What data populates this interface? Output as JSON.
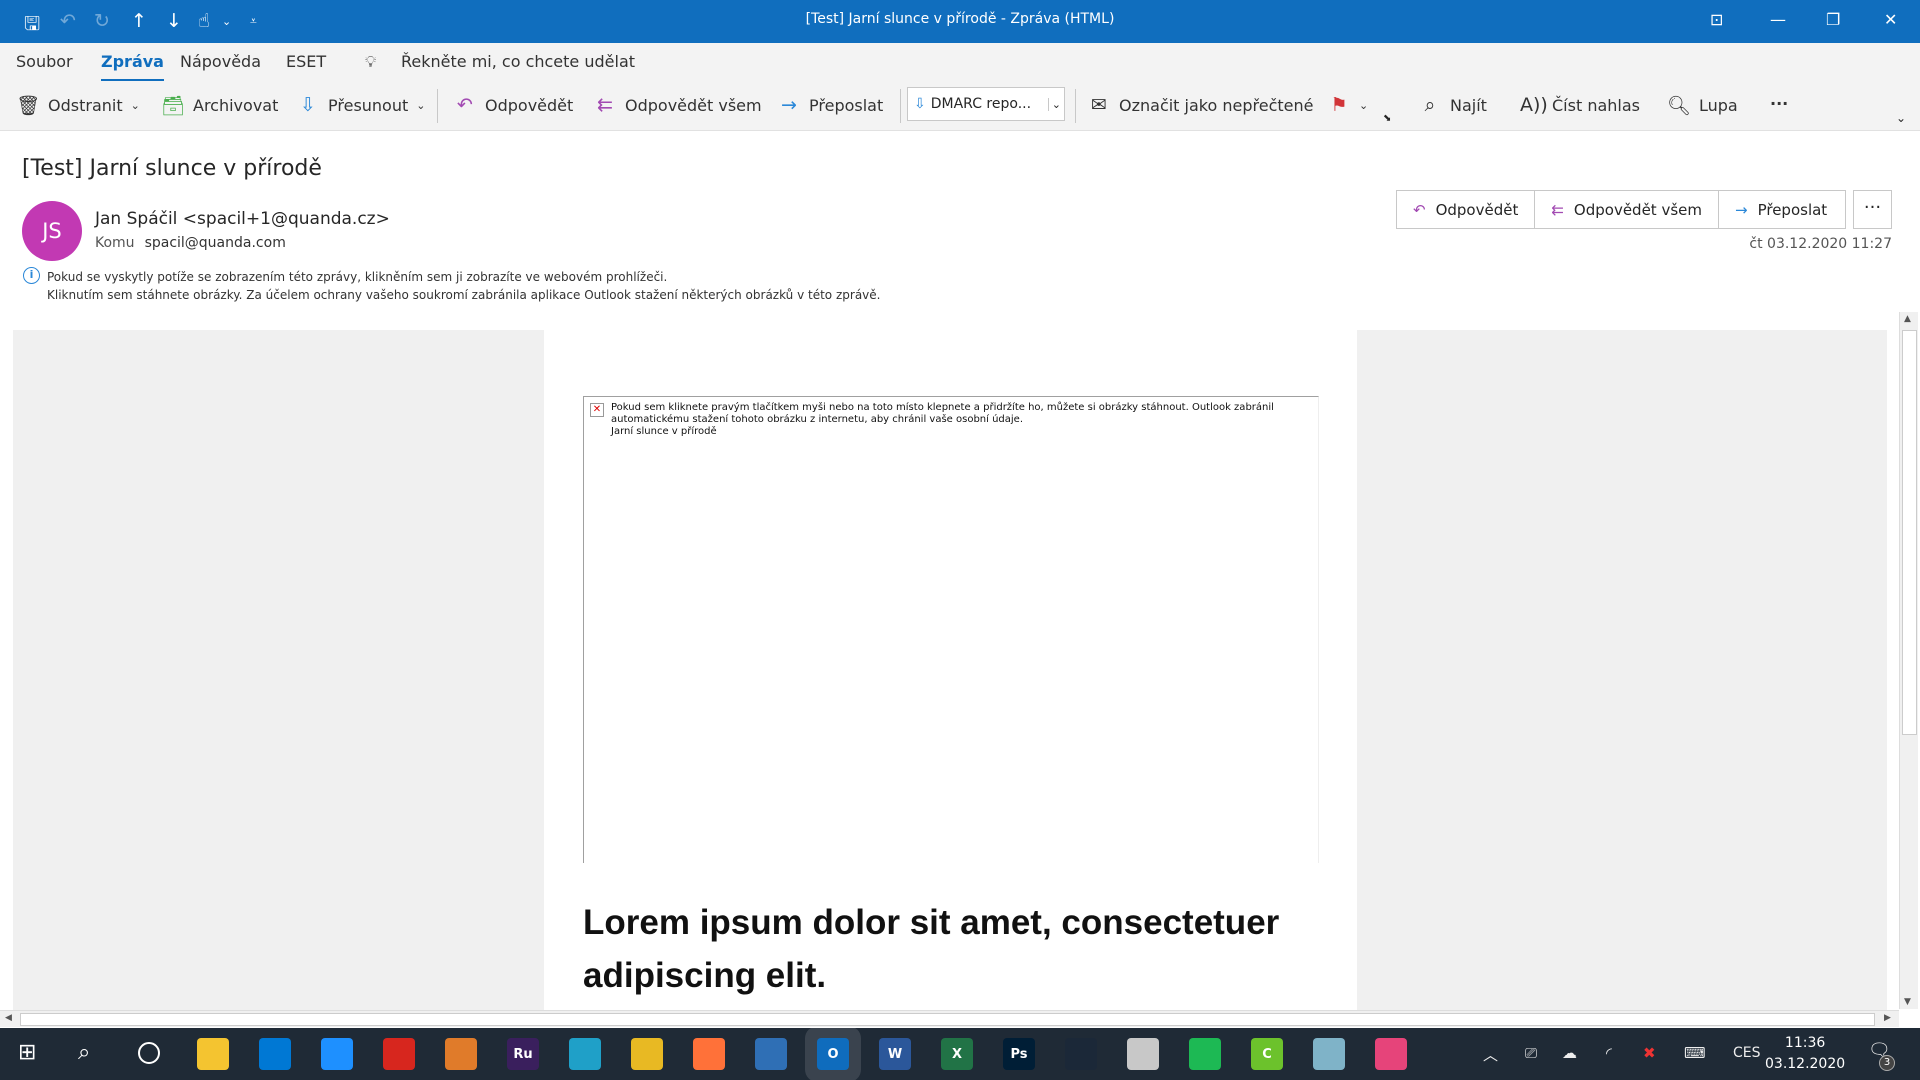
{
  "window": {
    "title": "[Test] Jarní slunce v přírodě  -  Zpráva (HTML)"
  },
  "menu_tabs": [
    "Soubor",
    "Zpráva",
    "Nápověda",
    "ESET"
  ],
  "tell_me": "Řekněte mi, co chcete udělat",
  "toolbar": {
    "delete": "Odstranit",
    "archive": "Archivovat",
    "move": "Přesunout",
    "reply": "Odpovědět",
    "reply_all": "Odpovědět všem",
    "forward": "Přeposlat",
    "quick_step": "DMARC repo...",
    "mark_unread": "Označit jako nepřečtené",
    "find": "Najít",
    "read_aloud": "Číst nahlas",
    "zoom": "Lupa",
    "more": "···"
  },
  "message": {
    "subject": "[Test] Jarní slunce v přírodě",
    "avatar_initials": "JS",
    "avatar_color": "#c239b3",
    "sender": "Jan Spáčil <spacil+1@quanda.cz>",
    "to_label": "Komu",
    "to": "spacil@quanda.com",
    "date": "čt 03.12.2020 11:27",
    "info_line1": "Pokud se vyskytly potíže se zobrazením této zprávy, klikněním sem ji zobrazíte ve webovém prohlížeči.",
    "info_line2": "Kliknutím sem stáhnete obrázky. Za účelem ochrany vašeho soukromí zabránila aplikace Outlook stažení některých obrázků v této zprávě."
  },
  "header_buttons": {
    "reply": "Odpovědět",
    "reply_all": "Odpovědět všem",
    "forward": "Přeposlat",
    "more": "···"
  },
  "body": {
    "blocked_image_msg": "Pokud sem kliknete pravým tlačítkem myši nebo na toto místo klepnete a přidržíte ho, můžete si obrázky stáhnout. Outlook zabránil automatickému stažení tohoto obrázku z internetu, aby chránil vaše osobní údaje.",
    "image_alt": "Jarní slunce v přírodě",
    "heading": "Lorem ipsum dolor sit amet, consectetuer adipiscing elit."
  },
  "taskbar": {
    "apps": [
      {
        "name": "file-explorer",
        "label": "",
        "color": "#f4c430"
      },
      {
        "name": "store",
        "label": "",
        "color": "#0078d4"
      },
      {
        "name": "app-blue",
        "label": "",
        "color": "#1e90ff"
      },
      {
        "name": "acrobat",
        "label": "",
        "color": "#d7261e"
      },
      {
        "name": "app-orange",
        "label": "",
        "color": "#e07b2a"
      },
      {
        "name": "audition",
        "label": "Ru",
        "color": "#3a1f5d"
      },
      {
        "name": "edge",
        "label": "",
        "color": "#1fa0c8"
      },
      {
        "name": "chrome",
        "label": "",
        "color": "#e8b923"
      },
      {
        "name": "firefox",
        "label": "",
        "color": "#ff7139"
      },
      {
        "name": "thunderbird",
        "label": "",
        "color": "#2f6fb5"
      },
      {
        "name": "outlook",
        "label": "O",
        "color": "#0f6cbd"
      },
      {
        "name": "word",
        "label": "W",
        "color": "#2b579a"
      },
      {
        "name": "excel",
        "label": "X",
        "color": "#217346"
      },
      {
        "name": "photoshop",
        "label": "Ps",
        "color": "#001e36"
      },
      {
        "name": "steam",
        "label": "",
        "color": "#1b2838"
      },
      {
        "name": "app-paint",
        "label": "",
        "color": "#c8c8c8"
      },
      {
        "name": "spotify",
        "label": "",
        "color": "#1db954"
      },
      {
        "name": "app-green",
        "label": "C",
        "color": "#6cc22c"
      },
      {
        "name": "app-notes",
        "label": "",
        "color": "#7fb3c8"
      },
      {
        "name": "app-drop",
        "label": "",
        "color": "#e6447a"
      }
    ],
    "language": "CES",
    "time": "11:36",
    "date": "03.12.2020",
    "notifications": "3"
  }
}
